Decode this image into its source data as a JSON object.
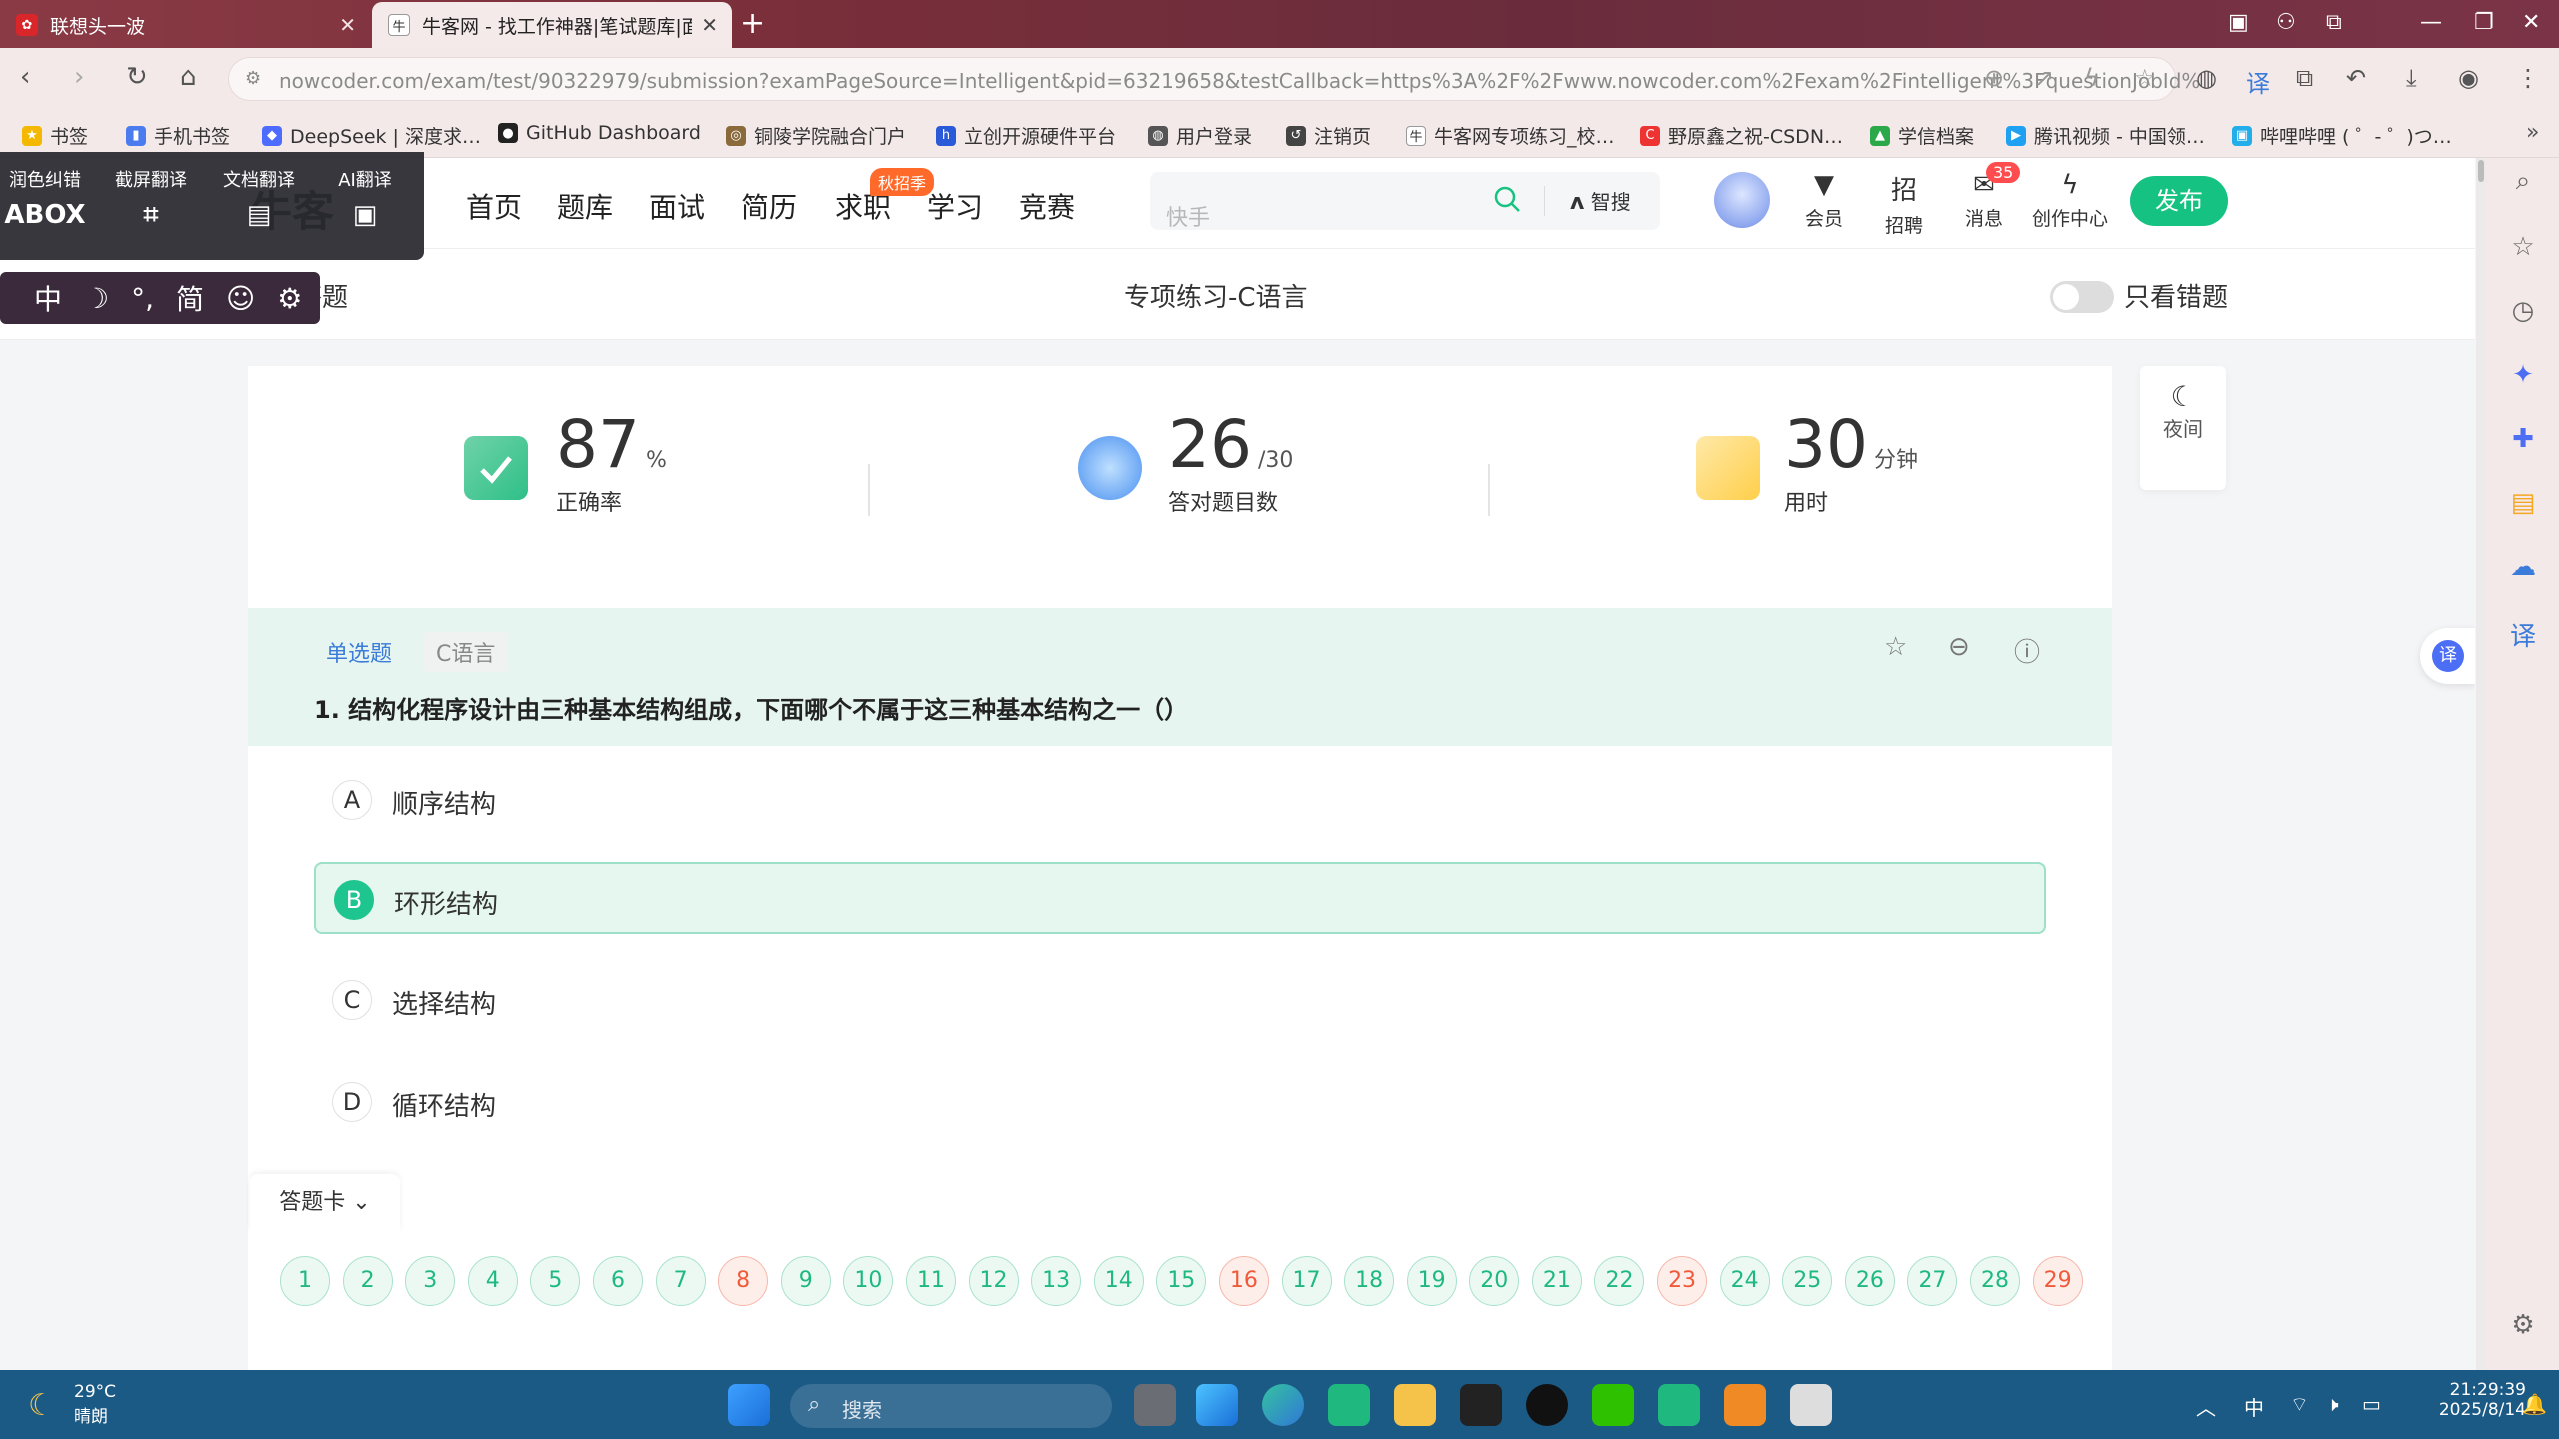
{
  "browser": {
    "tabs": [
      {
        "title": "联想头一波",
        "active": false
      },
      {
        "title": "牛客网 - 找工作神器|笔试题库|面…",
        "active": true
      }
    ],
    "url": "nowcoder.com/exam/test/90322979/submission?examPageSource=Intelligent&pid=63219658&testCallback=https%3A%2F%2Fwww.nowcoder.com%2Fexam%2Fintelligent%3FquestionJobId%3D...",
    "bookmarks": [
      "书签",
      "手机书签",
      "DeepSeek | 深度求…",
      "GitHub Dashboard",
      "铜陵学院融合门户",
      "立创开源硬件平台",
      "用户登录",
      "注销页",
      "牛客网专项练习_校…",
      "野原鑫之祝-CSDN…",
      "学信档案",
      "腾讯视频 - 中国领…",
      "哔哩哔哩 ( ゜- ゜)つ…"
    ]
  },
  "toolbox": {
    "items": [
      {
        "label": "润色纠错",
        "icon": "ABOX"
      },
      {
        "label": "截屏翻译",
        "icon": "crop-icon"
      },
      {
        "label": "文档翻译",
        "icon": "doc-icon"
      },
      {
        "label": "AI翻译",
        "icon": "ai-icon"
      }
    ],
    "ime": [
      "中",
      "☽",
      "°,",
      "简",
      "☺",
      "⚙"
    ]
  },
  "site": {
    "logo": "牛客",
    "nav": [
      "首页",
      "题库",
      "面试",
      "简历",
      "求职",
      "学习",
      "竞赛"
    ],
    "season_badge": "秋招季",
    "search_placeholder": "快手",
    "smart_search": "智搜",
    "header_items": [
      "会员",
      "招聘",
      "消息",
      "创作中心"
    ],
    "message_count": "35",
    "publish": "发布"
  },
  "subheader": {
    "back": "出答题",
    "title": "专项练习-C语言",
    "wrong_only": "只看错题"
  },
  "stats": [
    {
      "value": "87",
      "unit": "%",
      "label": "正确率"
    },
    {
      "value": "26",
      "unit": "/30",
      "label": "答对题目数"
    },
    {
      "value": "30",
      "unit": "分钟",
      "label": "用时"
    }
  ],
  "night_mode": "夜间",
  "question": {
    "type_tag": "单选题",
    "subject_tag": "C语言",
    "text": "1. 结构化程序设计由三种基本结构组成，下面哪个不属于这三种基本结构之一（）",
    "options": [
      {
        "letter": "A",
        "text": "顺序结构",
        "selected": false
      },
      {
        "letter": "B",
        "text": "环形结构",
        "selected": true
      },
      {
        "letter": "C",
        "text": "选择结构",
        "selected": false
      },
      {
        "letter": "D",
        "text": "循环结构",
        "selected": false
      }
    ]
  },
  "answer_card": {
    "label": "答题卡",
    "numbers": [
      "1",
      "2",
      "3",
      "4",
      "5",
      "6",
      "7",
      "8",
      "9",
      "10",
      "11",
      "12",
      "13",
      "14",
      "15",
      "16",
      "17",
      "18",
      "19",
      "20",
      "21",
      "22",
      "23",
      "24",
      "25",
      "26",
      "27",
      "28",
      "29"
    ],
    "wrong": [
      "8",
      "16",
      "23",
      "29"
    ]
  },
  "translate_float": "译",
  "taskbar": {
    "weather_temp": "29°C",
    "weather_desc": "晴朗",
    "search": "搜索",
    "ime": "中",
    "time": "21:29:39",
    "date": "2025/8/14"
  },
  "colors": {
    "accent": "#1fc58e",
    "publish": "#16c281",
    "wrong": "#f05a3a",
    "question_bg": "#e6f5f0",
    "taskbar": "#1c5a86",
    "tabbar": "#7a2f3a"
  }
}
